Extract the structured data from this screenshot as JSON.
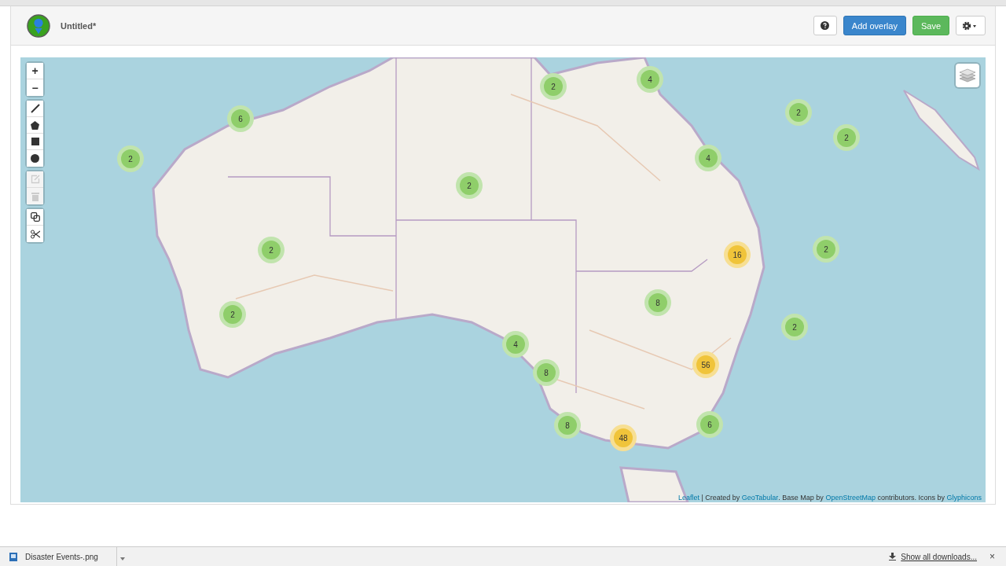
{
  "header": {
    "title": "Untitled*",
    "buttons": [
      {
        "kind": "help"
      },
      {
        "kind": "primary",
        "label": "Add overlay"
      },
      {
        "kind": "success",
        "label": "Save"
      },
      {
        "kind": "settings"
      }
    ]
  },
  "map": {
    "kind": "picture",
    "zoom": {
      "in": "+",
      "out": "−"
    },
    "draw_tools": [
      {
        "kind": "line",
        "disabled": false
      },
      {
        "kind": "polygon",
        "disabled": false
      },
      {
        "kind": "rectangle",
        "disabled": false
      },
      {
        "kind": "circle",
        "disabled": false
      }
    ],
    "edit_tools": [
      {
        "kind": "edit",
        "disabled": true
      },
      {
        "kind": "delete",
        "disabled": true
      }
    ],
    "extra_tools": [
      {
        "kind": "copy",
        "disabled": false
      },
      {
        "kind": "cut",
        "disabled": false
      }
    ],
    "clusters": [
      {
        "count": "2",
        "color": "#8fce6a"
      },
      {
        "count": "4",
        "color": "#8fce6a"
      },
      {
        "count": "6",
        "color": "#8fce6a"
      },
      {
        "count": "2",
        "color": "#8fce6a"
      },
      {
        "count": "2",
        "color": "#8fce6a"
      },
      {
        "count": "2",
        "color": "#8fce6a"
      },
      {
        "count": "4",
        "color": "#8fce6a"
      },
      {
        "count": "2",
        "color": "#8fce6a"
      },
      {
        "count": "16",
        "color": "#f0c43a"
      },
      {
        "count": "2",
        "color": "#8fce6a"
      },
      {
        "count": "2",
        "color": "#8fce6a"
      },
      {
        "count": "8",
        "color": "#8fce6a"
      },
      {
        "count": "2",
        "color": "#8fce6a"
      },
      {
        "count": "2",
        "color": "#8fce6a"
      },
      {
        "count": "4",
        "color": "#8fce6a"
      },
      {
        "count": "8",
        "color": "#8fce6a"
      },
      {
        "count": "56",
        "color": "#f0c43a"
      },
      {
        "count": "6",
        "color": "#8fce6a"
      },
      {
        "count": "8",
        "color": "#8fce6a"
      },
      {
        "count": "48",
        "color": "#f0c43a"
      }
    ],
    "attribution": [
      {
        "kind": "link",
        "text": "Leaflet"
      },
      {
        "kind": "text",
        "text": " | Created by "
      },
      {
        "kind": "link",
        "text": "GeoTabular"
      },
      {
        "kind": "text",
        "text": ". Base Map by "
      },
      {
        "kind": "link",
        "text": "OpenStreetMap"
      },
      {
        "kind": "text",
        "text": " contributors. Icons by "
      },
      {
        "kind": "link",
        "text": "Glyphicons"
      }
    ]
  },
  "download_bar": {
    "file": "Disaster Events-.png",
    "show_all": "Show all downloads...",
    "close": "×"
  }
}
